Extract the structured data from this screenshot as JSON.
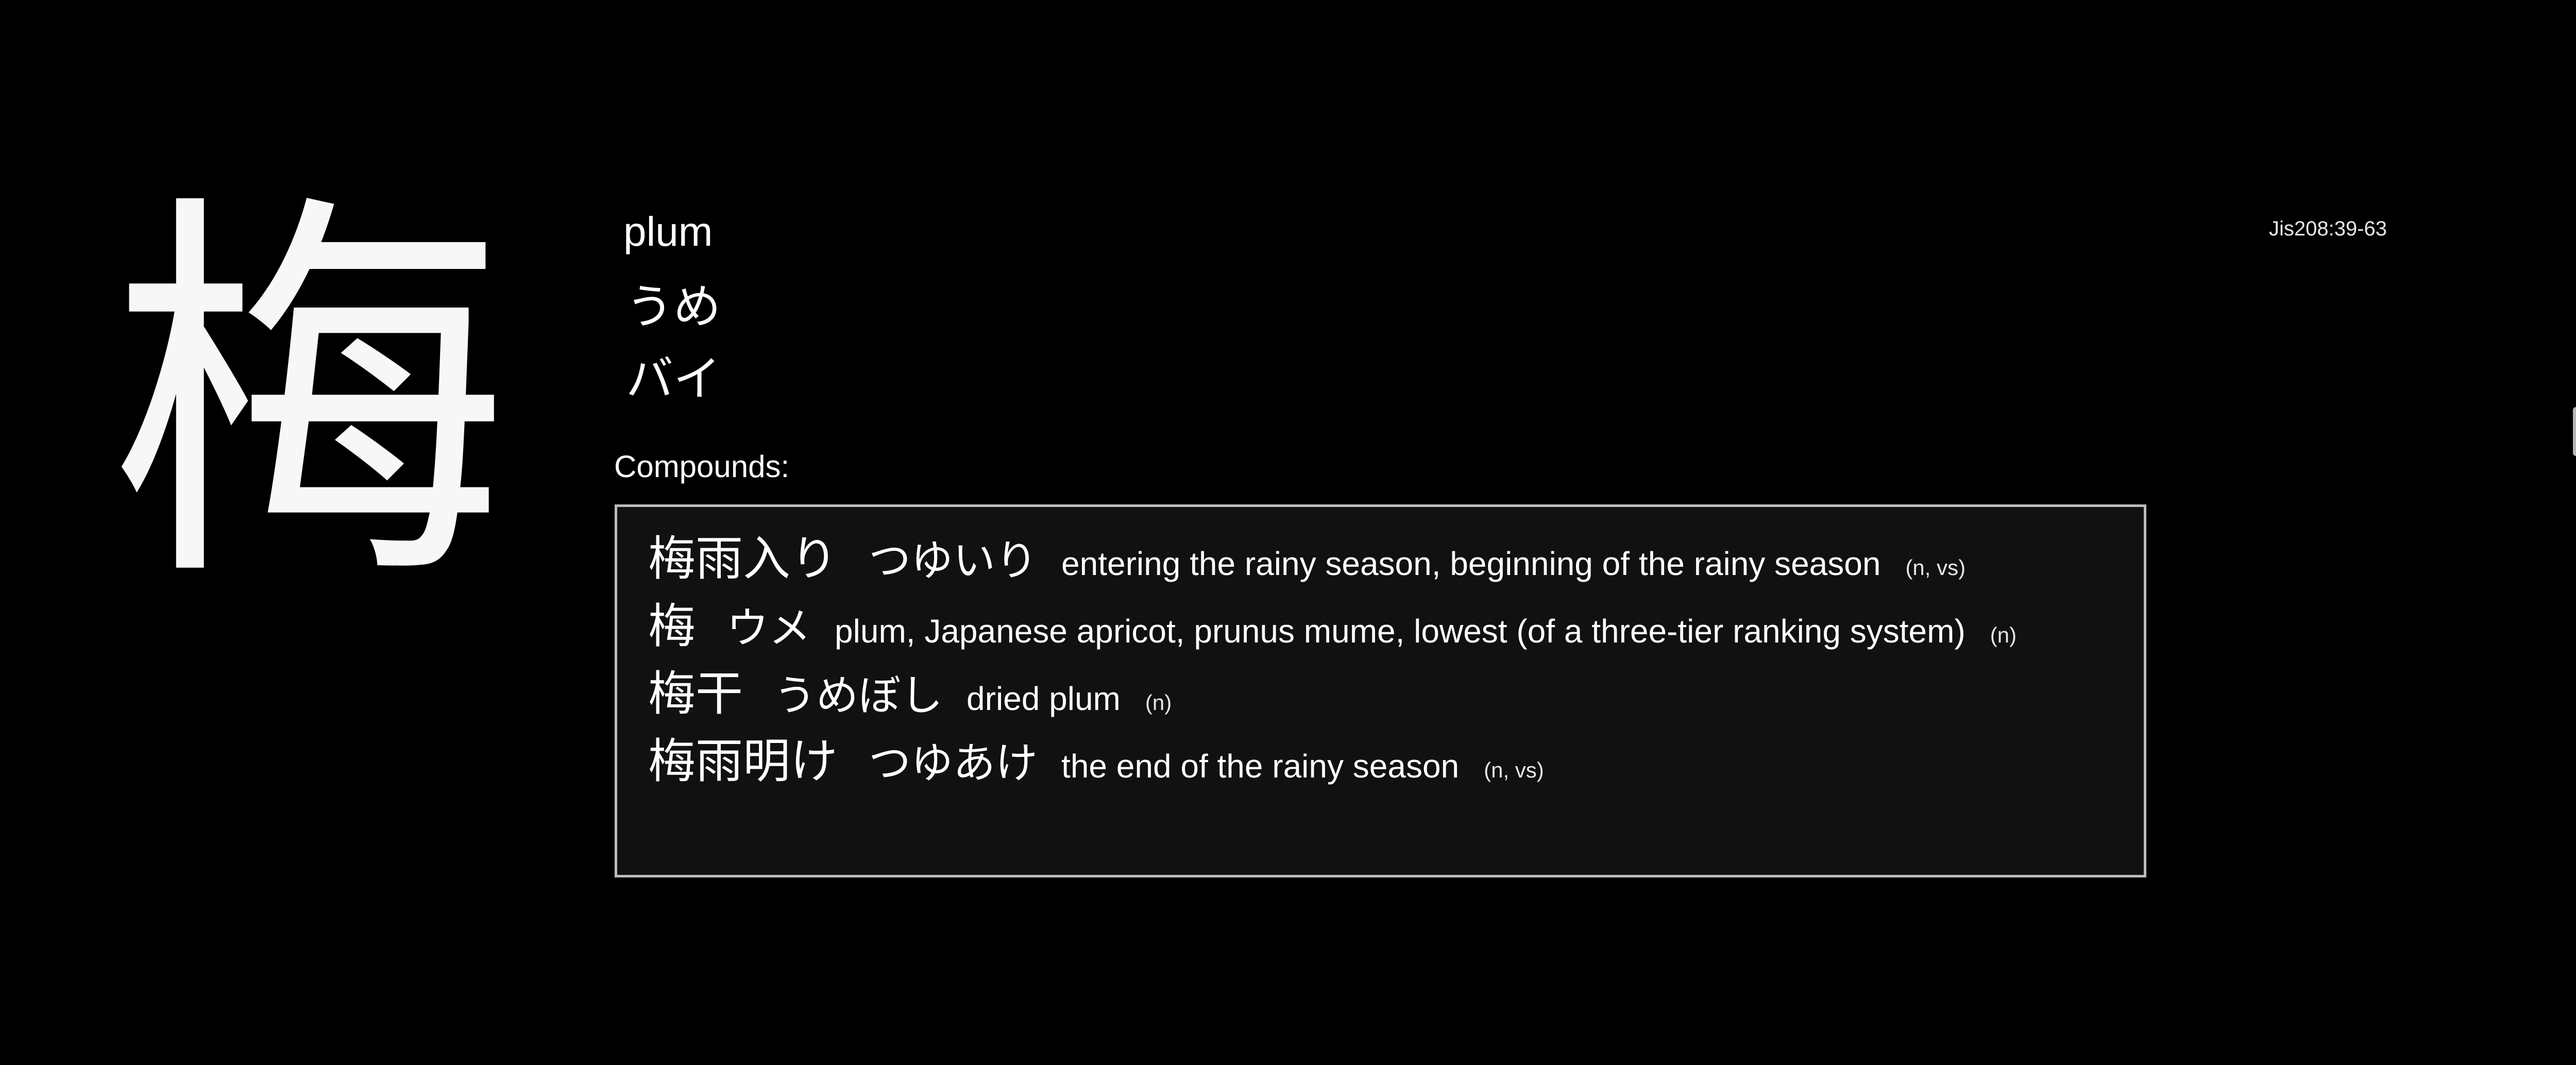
{
  "kanji": {
    "character": "梅",
    "meaning": "plum",
    "kun_reading": "うめ",
    "on_reading": "バイ",
    "jis_code": "Jis208:39-63"
  },
  "compounds": {
    "label": "Compounds:",
    "items": [
      {
        "word": "梅雨入り",
        "reading": "つゆいり",
        "gloss": "entering the rainy season, beginning of the rainy season",
        "pos": "(n, vs)"
      },
      {
        "word": "梅",
        "reading": "ウメ",
        "gloss": "plum, Japanese apricot, prunus mume, lowest (of a three-tier ranking system)",
        "pos": "(n)"
      },
      {
        "word": "梅干",
        "reading": "うめぼし",
        "gloss": "dried plum",
        "pos": "(n)"
      },
      {
        "word": "梅雨明け",
        "reading": "つゆあけ",
        "gloss": "the end of the rainy season",
        "pos": "(n, vs)"
      }
    ]
  },
  "colors": {
    "background": "#000000",
    "text": "#ffffff",
    "box_background": "#111111",
    "box_border": "#bcbcbc"
  }
}
